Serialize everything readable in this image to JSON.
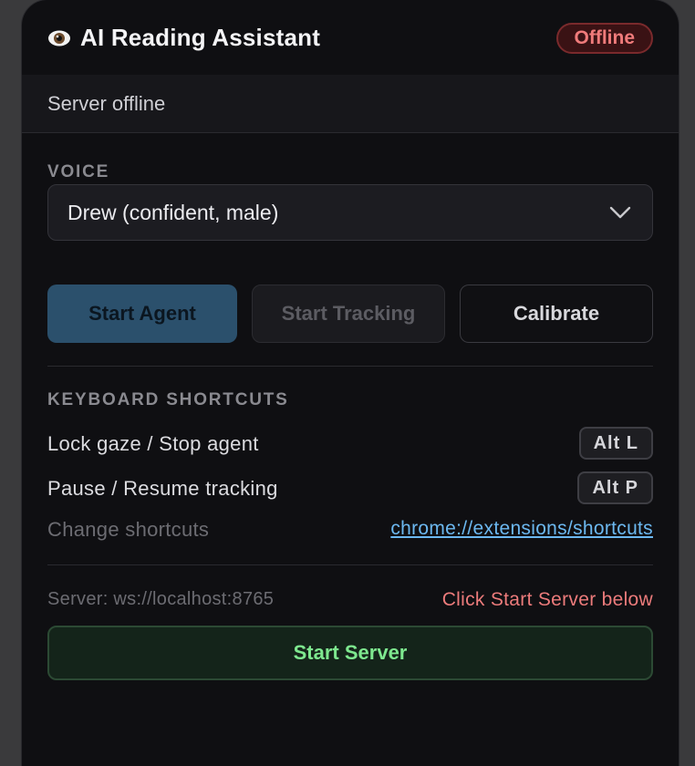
{
  "header": {
    "title": "AI Reading Assistant",
    "status": "Offline"
  },
  "server_status": "Server offline",
  "voice": {
    "label": "VOICE",
    "selected": "Drew (confident, male)"
  },
  "actions": {
    "start_agent": "Start Agent",
    "start_tracking": "Start Tracking",
    "calibrate": "Calibrate"
  },
  "shortcuts": {
    "label": "KEYBOARD SHORTCUTS",
    "items": [
      {
        "label": "Lock gaze / Stop agent",
        "keys": "Alt L"
      },
      {
        "label": "Pause / Resume tracking",
        "keys": "Alt P"
      }
    ],
    "change_label": "Change shortcuts",
    "change_link": "chrome://extensions/shortcuts"
  },
  "server": {
    "url": "Server: ws://localhost:8765",
    "hint": "Click Start Server below",
    "start_label": "Start Server"
  },
  "colors": {
    "panel_bg": "#0f0f12",
    "offline_red": "#f07b7b",
    "agent_blue": "#2b506c",
    "link_blue": "#6cb8f0",
    "server_green": "#7ee88f"
  },
  "icons": {
    "title_icon": "eye-icon",
    "select_icon": "chevron-down-icon"
  }
}
